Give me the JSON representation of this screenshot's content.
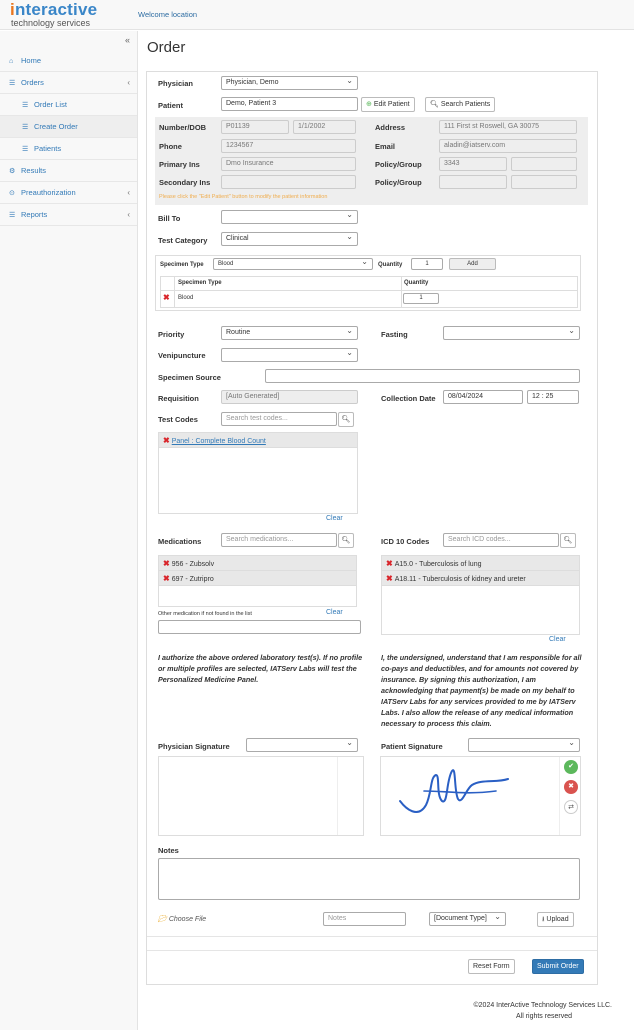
{
  "brand": {
    "logo_pre": "n",
    "logo_main": "teractive",
    "logo_i": "i",
    "logo_sub": "technology services"
  },
  "header": {
    "welcome": "Welcome location"
  },
  "sidebar": {
    "collapse_icon": "«",
    "items": [
      {
        "label": "Home",
        "icon": "home-icon"
      },
      {
        "label": "Orders",
        "icon": "list-icon"
      },
      {
        "label": "Order List",
        "icon": "list-icon"
      },
      {
        "label": "Create Order",
        "icon": "list-icon"
      },
      {
        "label": "Patients",
        "icon": "list-icon"
      },
      {
        "label": "Results",
        "icon": "cogs-icon"
      },
      {
        "label": "Preauthorization",
        "icon": "gear-icon"
      },
      {
        "label": "Reports",
        "icon": "list-icon"
      }
    ]
  },
  "page": {
    "title": "Order"
  },
  "form": {
    "physician_label": "Physician",
    "physician_value": "Physician, Demo",
    "patient_label": "Patient",
    "patient_value": "Demo, Patient 3",
    "edit_patient": "Edit Patient",
    "search_patients": "Search Patients",
    "info": {
      "number_dob_label": "Number/DOB",
      "number": "P01139",
      "dob": "1/1/2002",
      "address_label": "Address",
      "address": "111 First st Roswell, GA 30075",
      "phone_label": "Phone",
      "phone": "1234567",
      "email_label": "Email",
      "email": "aladin@iatserv.com",
      "primary_ins_label": "Primary Ins",
      "primary_ins": "Dmo Insurance",
      "policy_group_label": "Policy/Group",
      "policy": "3343",
      "secondary_ins_label": "Secondary Ins",
      "policy_group_label2": "Policy/Group",
      "warning": "Please click the \"Edit Patient\" button to modify the patient information"
    },
    "bill_to_label": "Bill To",
    "test_category_label": "Test Category",
    "test_category_value": "Clinical",
    "specimen": {
      "type_label": "Specimen Type",
      "type_value": "Blood",
      "quantity_label": "Quantity",
      "quantity_value": "1",
      "add_button": "Add",
      "col_type": "Specimen Type",
      "col_qty": "Quantity",
      "rows": [
        {
          "type": "Blood",
          "qty": "1"
        }
      ]
    },
    "priority_label": "Priority",
    "priority_value": "Routine",
    "fasting_label": "Fasting",
    "venipuncture_label": "Venipuncture",
    "specimen_source_label": "Specimen Source",
    "requisition_label": "Requisition",
    "requisition_placeholder": "[Auto Generated]",
    "collection_date_label": "Collection Date",
    "collection_date": "08/04/2024",
    "collection_hour": "12",
    "collection_minute": "25",
    "test_codes_label": "Test Codes",
    "test_codes_placeholder": "Search test codes...",
    "test_codes": [
      "Panel : Complete Blood Count"
    ],
    "clear": "Clear",
    "medications_label": "Medications",
    "medications_placeholder": "Search medications...",
    "medications": [
      "956 - Zubsolv",
      "697 - Zutripro"
    ],
    "other_med_label": "Other medication if not found in the list",
    "icd_label": "ICD 10 Codes",
    "icd_placeholder": "Search ICD codes...",
    "icd_codes": [
      "A15.0 - Tuberculosis of lung",
      "A18.11 - Tuberculosis of kidney and ureter"
    ],
    "auth_text_left": "I authorize the above ordered laboratory test(s). If no profile or multiple profiles are selected, IATServ Labs will test the Personalized Medicine Panel.",
    "auth_text_right": "I, the undersigned, understand that I am responsible for all co-pays and deductibles, and for amounts not covered by insurance. By signing this authorization, I am acknowledging that payment(s) be made on my behalf to IATServ Labs for any services provided to me by IATServ Labs. I also allow the release of any medical information necessary to process this claim.",
    "physician_signature_label": "Physician Signature",
    "patient_signature_label": "Patient Signature",
    "notes_label": "Notes",
    "choose_file": "Choose File",
    "notes_placeholder": "Notes",
    "doc_type": "[Document Type]",
    "upload": "Upload",
    "reset": "Reset Form",
    "submit": "Submit Order"
  },
  "footer": {
    "line1": "©2024 InterActive Technology Services LLC.",
    "line2": "All rights reserved"
  },
  "colors": {
    "brand_blue": "#3a86c8",
    "brand_orange": "#e8761f",
    "submit": "#337ab7",
    "warning": "#f0ad4e"
  }
}
